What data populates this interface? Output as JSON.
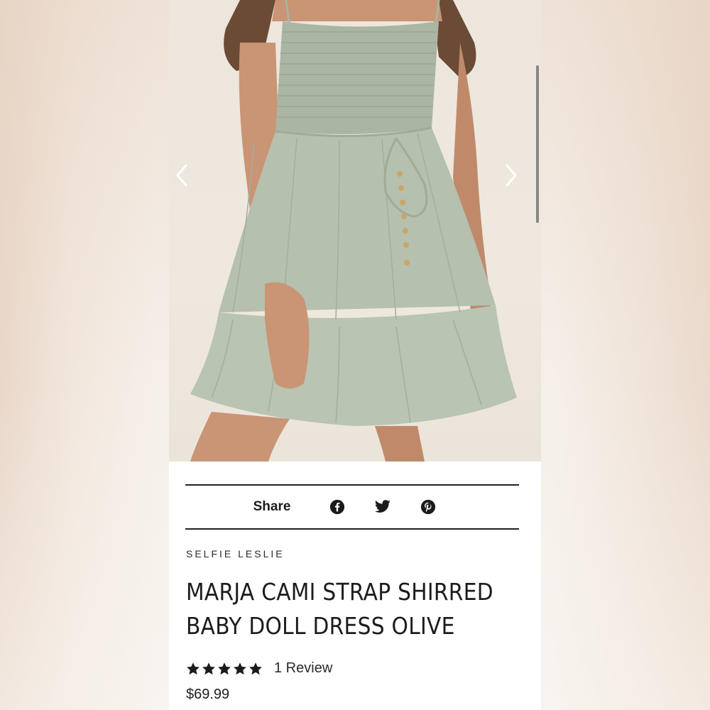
{
  "product": {
    "brand": "SELFIE LESLIE",
    "title_lines": [
      "MARJA CAMI STRAP SHIRRED",
      "BABY DOLL DRESS OLIVE"
    ],
    "rating_stars": 5,
    "review_text": "1 Review",
    "price": "$69.99"
  },
  "share": {
    "label": "Share",
    "icons": [
      "facebook-icon",
      "twitter-icon",
      "pinterest-icon"
    ]
  },
  "gallery": {
    "prev_icon": "chevron-left-icon",
    "next_icon": "chevron-right-icon"
  },
  "colors": {
    "dress": "#b7c2b0",
    "text": "#1c1c1c"
  }
}
